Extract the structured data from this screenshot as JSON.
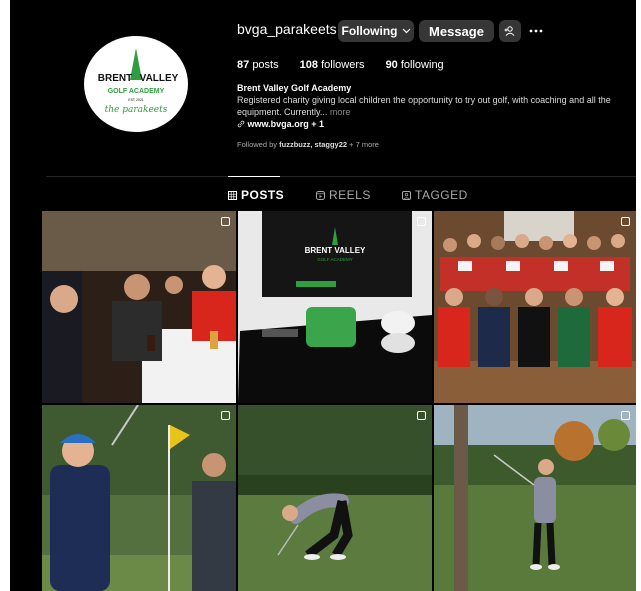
{
  "profile": {
    "username": "bvga_parakeets",
    "following_button": "Following",
    "message_button": "Message",
    "stats": {
      "posts_count": "87",
      "posts_label": "posts",
      "followers_count": "108",
      "followers_label": "followers",
      "following_count": "90",
      "following_label": "following"
    },
    "bio": {
      "name": "Brent Valley Golf Academy",
      "text": "Registered charity giving local children the opportunity to try out golf, with coaching and all the equipment. Currently...",
      "more": "more",
      "link": "www.bvga.org",
      "link_extra": "+ 1"
    },
    "followed_by": {
      "prefix": "Followed by",
      "names": "fuzzbuzz, staggy22",
      "suffix": "+ 7 more"
    }
  },
  "logo": {
    "line1_left": "BRENT",
    "line1_right": "VALLEY",
    "line2": "GOLF ACADEMY",
    "est": "EST 2021",
    "script": "the parakeets"
  },
  "tabs": [
    {
      "label": "POSTS",
      "icon": "grid-icon",
      "active": true
    },
    {
      "label": "REELS",
      "icon": "reels-icon",
      "active": false
    },
    {
      "label": "TAGGED",
      "icon": "tagged-icon",
      "active": false
    }
  ],
  "posts": [
    {
      "subject": "Golfers seated at a dinner table applauding",
      "multi": true
    },
    {
      "subject": "Brent Valley presentation box with golf balls",
      "multi": true,
      "box_title": "BRENT VALLEY",
      "box_sub": "GOLF ACADEMY"
    },
    {
      "subject": "Group photo of juniors holding certificates",
      "multi": true
    },
    {
      "subject": "Junior golfer in blue cap finishing swing beside flag",
      "multi": true
    },
    {
      "subject": "Junior golfer crouching on the course",
      "multi": true
    },
    {
      "subject": "Junior golfer swinging near a tree",
      "multi": true
    }
  ],
  "colors": {
    "background": "#000000",
    "button": "#363636",
    "logo_green": "#2f9e3f",
    "tab_active": "#ffffff",
    "tab_inactive": "#a8a8a8"
  }
}
